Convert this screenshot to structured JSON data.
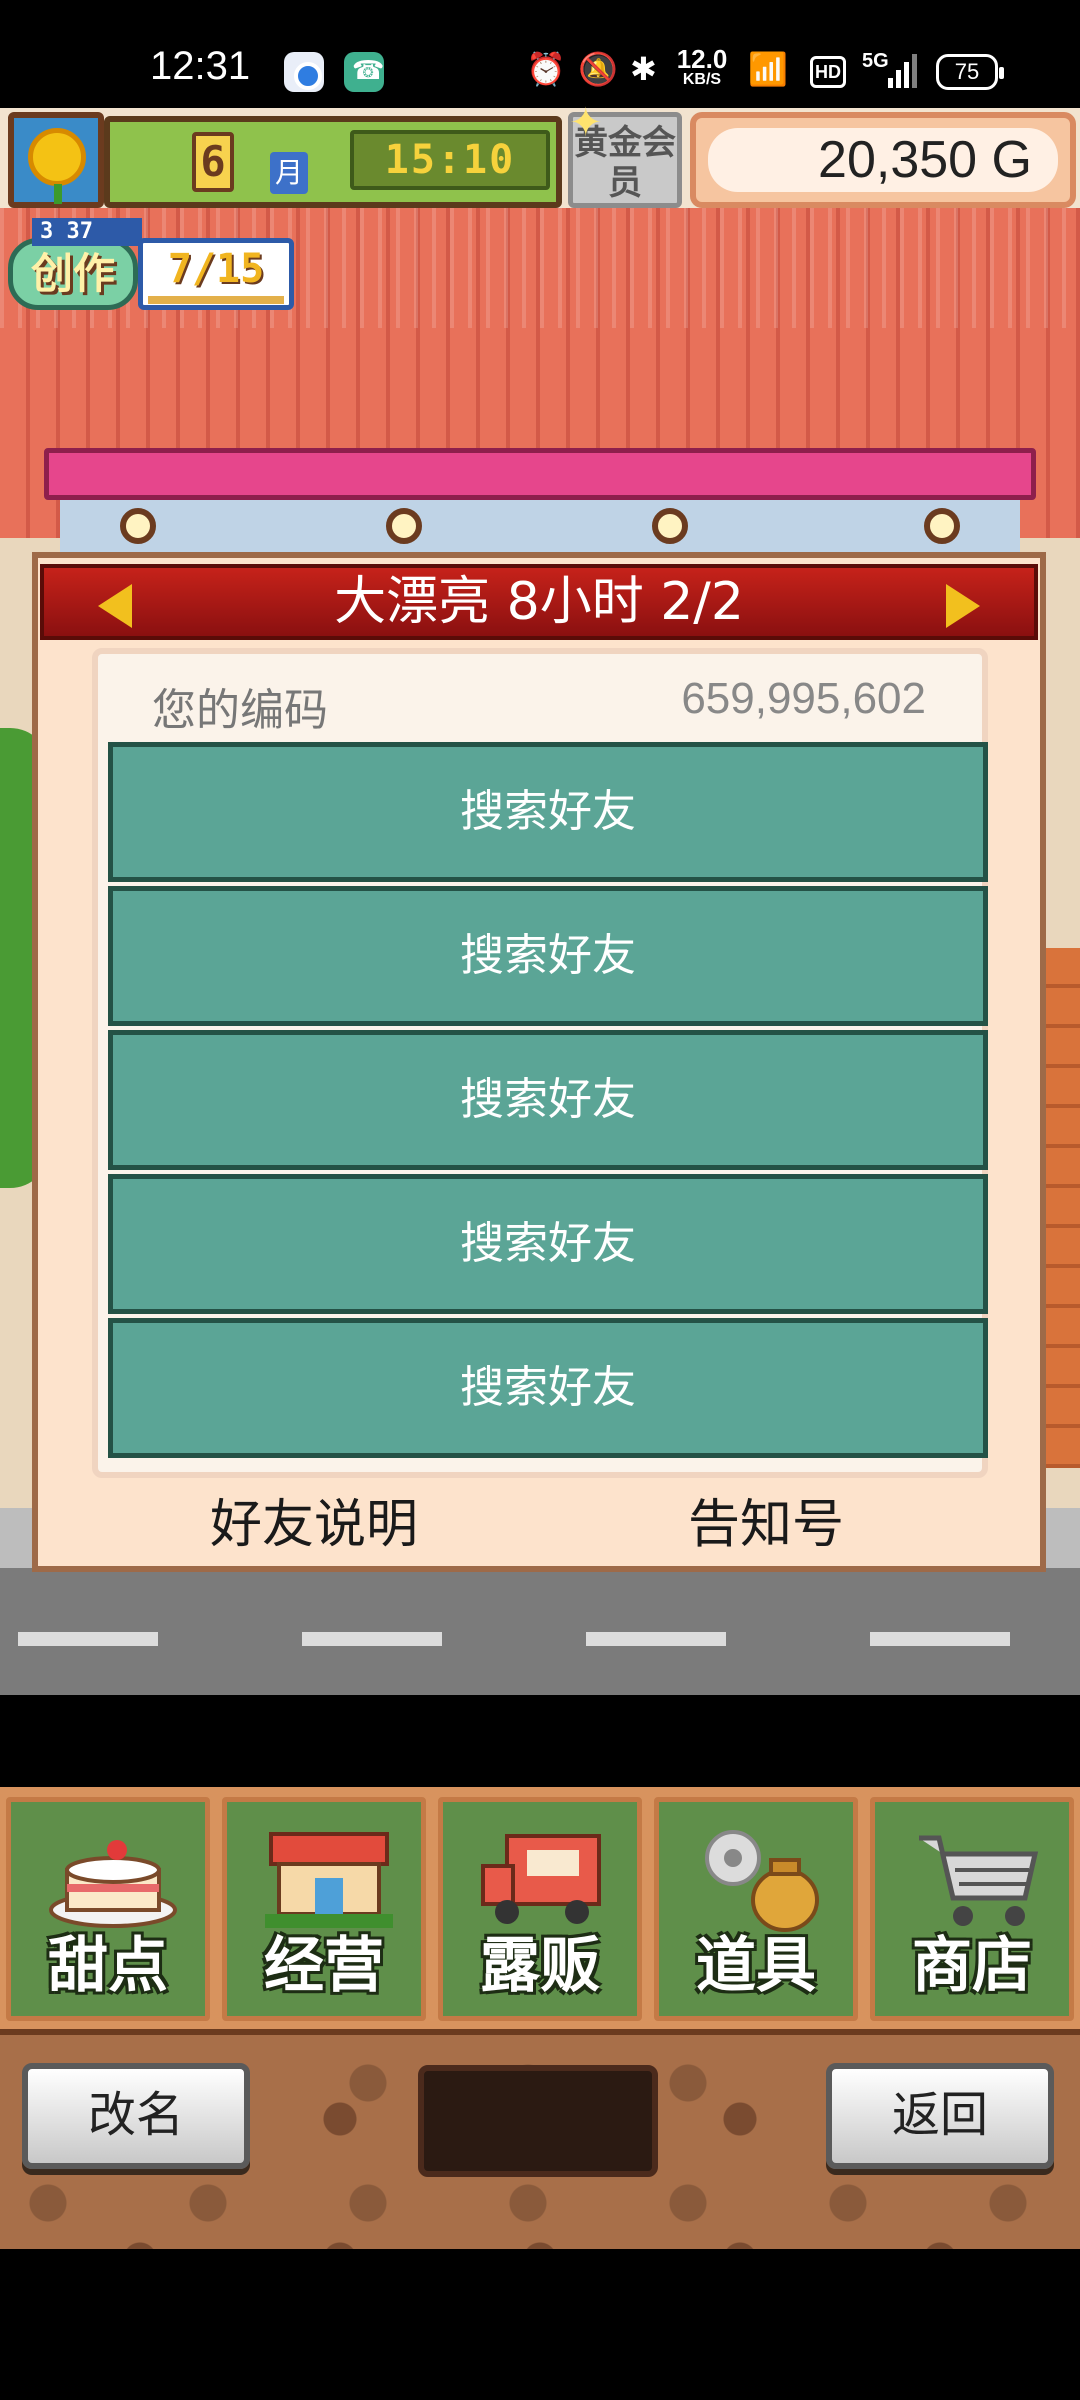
{
  "status_bar": {
    "time": "12:31",
    "speed_value": "12.0",
    "speed_unit": "KB/S",
    "hd": "HD",
    "signal": "5G",
    "battery": "75"
  },
  "hud": {
    "month_number": "6",
    "month_label": "月",
    "clock": "15:10",
    "member_label": "黄金会员",
    "money": "20,350 G",
    "create_level": "3 37",
    "create_label": "创作",
    "create_count": "7/15"
  },
  "dialog": {
    "title": "大漂亮  8小时 2/2",
    "code_label": "您的编码",
    "code_value": "659,995,602",
    "slots": [
      "搜索好友",
      "搜索好友",
      "搜索好友",
      "搜索好友",
      "搜索好友"
    ],
    "friend_help": "好友说明",
    "notice": "告知号"
  },
  "menu": {
    "items": [
      {
        "label": "甜点",
        "icon": "cake-icon"
      },
      {
        "label": "经营",
        "icon": "store-icon"
      },
      {
        "label": "露贩",
        "icon": "food-truck-icon"
      },
      {
        "label": "道具",
        "icon": "items-bag-icon"
      },
      {
        "label": "商店",
        "icon": "shopping-cart-icon"
      }
    ]
  },
  "actions": {
    "rename": "改名",
    "back": "返回"
  },
  "colors": {
    "dialog_header": "#c6221a",
    "slot": "#5ba596",
    "menu_tile": "#5f8f4a"
  }
}
